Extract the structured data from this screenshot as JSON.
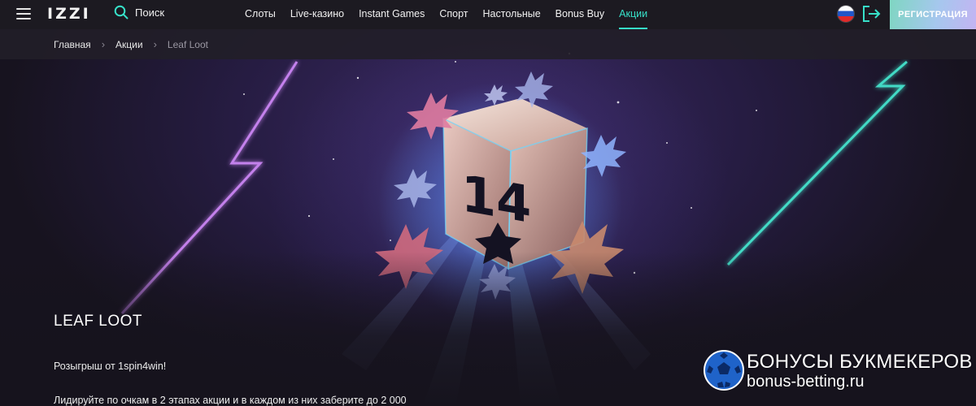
{
  "header": {
    "logo": "IZZI",
    "search_label": "Поиск",
    "nav": [
      {
        "label": "Слоты"
      },
      {
        "label": "Live-казино"
      },
      {
        "label": "Instant Games"
      },
      {
        "label": "Спорт"
      },
      {
        "label": "Настольные"
      },
      {
        "label": "Bonus Buy"
      },
      {
        "label": "Акции",
        "active": true
      }
    ],
    "language_flag": "russia-flag",
    "register_label": "РЕГИСТРАЦИЯ",
    "colors": {
      "accent": "#37e0c8",
      "header_bg": "#1c1a21"
    }
  },
  "breadcrumb": {
    "home": "Главная",
    "promotions": "Акции",
    "current": "Leaf Loot"
  },
  "promo": {
    "title": "LEAF LOOT",
    "line1": "Розыгрыш от 1spin4win!",
    "line2": "Лидируйте по очкам в 2 этапах акции и в каждом из них заберите до 2 000",
    "banner_number": "14"
  },
  "watermark": {
    "line1": "БОНУСЫ БУКМЕКЕРОВ",
    "line2": "bonus-betting.ru"
  }
}
